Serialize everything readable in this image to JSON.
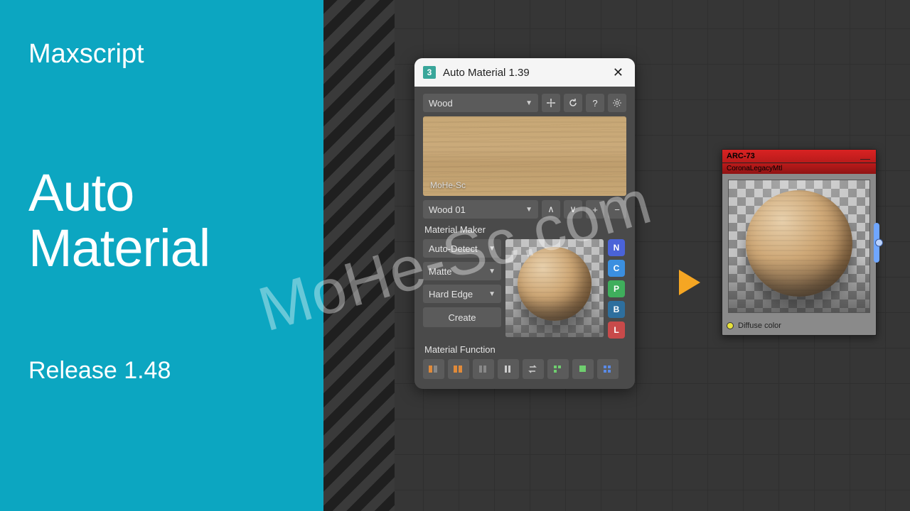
{
  "banner": {
    "subtitle": "Maxscript",
    "title_line1": "Auto",
    "title_line2": "Material",
    "release": "Release 1.48"
  },
  "watermark": "MoHe-Sc.com",
  "dialog": {
    "title": "Auto Material 1.39",
    "category": "Wood",
    "preview_label": "MoHe-Sc",
    "preset": "Wood 01",
    "section_maker": "Material Maker",
    "detect": "Auto-Detect",
    "finish": "Matte",
    "edge": "Hard Edge",
    "create": "Create",
    "section_func": "Material Function",
    "tags": [
      {
        "label": "N",
        "color": "#4a63d8"
      },
      {
        "label": "C",
        "color": "#3b8fe0"
      },
      {
        "label": "P",
        "color": "#3fae5c"
      },
      {
        "label": "B",
        "color": "#2e6f9e"
      },
      {
        "label": "L",
        "color": "#c84a4a"
      }
    ]
  },
  "node": {
    "name": "ARC-73",
    "type": "CoronaLegacyMtl",
    "output": "Diffuse color"
  }
}
